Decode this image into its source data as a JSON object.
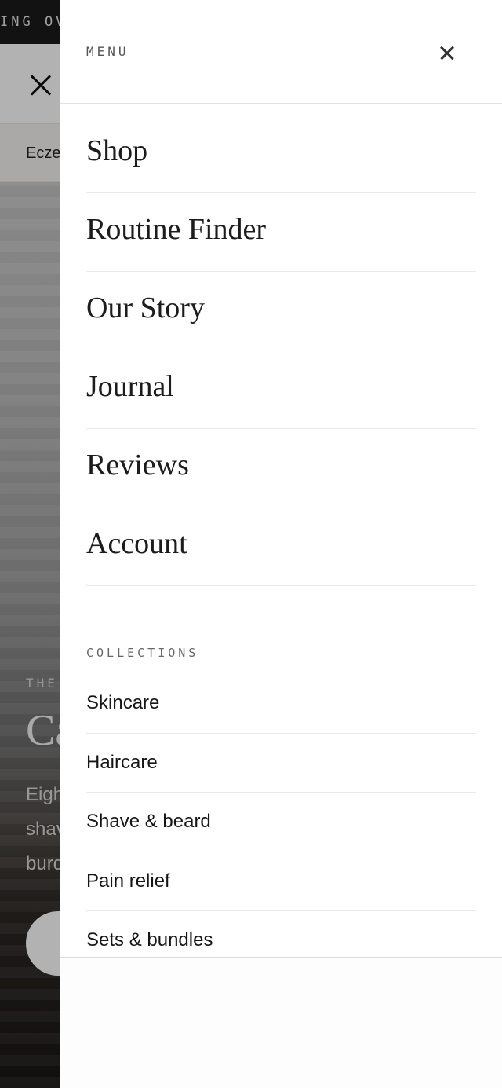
{
  "background": {
    "announcement": "ING OV",
    "tab_label": "Ecze",
    "hero": {
      "eyebrow": "THE",
      "heading": "Ca",
      "description_lines": [
        "Eigh",
        "shav",
        "burd"
      ]
    }
  },
  "drawer": {
    "title": "MENU",
    "close_icon": "close-icon",
    "nav_items": [
      {
        "label": "Shop"
      },
      {
        "label": "Routine Finder"
      },
      {
        "label": "Our Story"
      },
      {
        "label": "Journal"
      },
      {
        "label": "Reviews"
      },
      {
        "label": "Account"
      }
    ],
    "collections_title": "COLLECTIONS",
    "collections": [
      {
        "label": "Skincare"
      },
      {
        "label": "Haircare"
      },
      {
        "label": "Shave & beard"
      },
      {
        "label": "Pain relief"
      },
      {
        "label": "Sets & bundles"
      }
    ]
  },
  "colors": {
    "overlay": "rgba(0,0,0,0.30)",
    "drawer_bg": "#ffffff",
    "text": "#1c1c1c",
    "divider": "#e9e9e9"
  }
}
